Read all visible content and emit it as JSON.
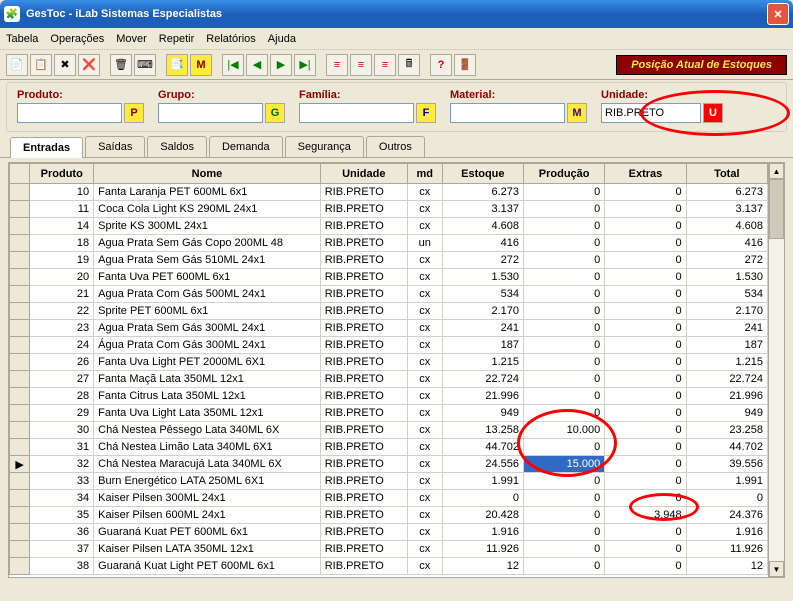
{
  "window": {
    "title": "GesToc - iLab Sistemas Especialistas"
  },
  "menu": [
    "Tabela",
    "Operações",
    "Mover",
    "Repetir",
    "Relatórios",
    "Ajuda"
  ],
  "banner": "Posição Atual de Estoques",
  "filters": {
    "produto": {
      "label": "Produto:",
      "value": "",
      "btn": "P"
    },
    "grupo": {
      "label": "Grupo:",
      "value": "",
      "btn": "G"
    },
    "familia": {
      "label": "Família:",
      "value": "",
      "btn": "F"
    },
    "material": {
      "label": "Material:",
      "value": "",
      "btn": "M"
    },
    "unidade": {
      "label": "Unidade:",
      "value": "RIB.PRETO",
      "btn": "U"
    }
  },
  "tabs": [
    "Entradas",
    "Saídas",
    "Saldos",
    "Demanda",
    "Segurança",
    "Outros"
  ],
  "activeTab": 0,
  "columns": [
    "Produto",
    "Nome",
    "Unidade",
    "md",
    "Estoque",
    "Produção",
    "Extras",
    "Total"
  ],
  "rows": [
    {
      "p": "10",
      "n": "Fanta Laranja PET 600ML 6x1",
      "u": "RIB.PRETO",
      "m": "cx",
      "e": "6.273",
      "pr": "0",
      "x": "0",
      "t": "6.273"
    },
    {
      "p": "11",
      "n": "Coca Cola Light KS 290ML 24x1",
      "u": "RIB.PRETO",
      "m": "cx",
      "e": "3.137",
      "pr": "0",
      "x": "0",
      "t": "3.137"
    },
    {
      "p": "14",
      "n": "Sprite KS 300ML 24x1",
      "u": "RIB.PRETO",
      "m": "cx",
      "e": "4.608",
      "pr": "0",
      "x": "0",
      "t": "4.608"
    },
    {
      "p": "18",
      "n": "Agua Prata Sem Gás Copo 200ML 48",
      "u": "RIB.PRETO",
      "m": "un",
      "e": "416",
      "pr": "0",
      "x": "0",
      "t": "416"
    },
    {
      "p": "19",
      "n": "Agua Prata Sem Gás 510ML 24x1",
      "u": "RIB.PRETO",
      "m": "cx",
      "e": "272",
      "pr": "0",
      "x": "0",
      "t": "272"
    },
    {
      "p": "20",
      "n": "Fanta Uva PET 600ML 6x1",
      "u": "RIB.PRETO",
      "m": "cx",
      "e": "1.530",
      "pr": "0",
      "x": "0",
      "t": "1.530"
    },
    {
      "p": "21",
      "n": "Agua Prata Com Gás 500ML 24x1",
      "u": "RIB.PRETO",
      "m": "cx",
      "e": "534",
      "pr": "0",
      "x": "0",
      "t": "534"
    },
    {
      "p": "22",
      "n": "Sprite PET 600ML 6x1",
      "u": "RIB.PRETO",
      "m": "cx",
      "e": "2.170",
      "pr": "0",
      "x": "0",
      "t": "2.170"
    },
    {
      "p": "23",
      "n": "Agua Prata Sem Gás 300ML 24x1",
      "u": "RIB.PRETO",
      "m": "cx",
      "e": "241",
      "pr": "0",
      "x": "0",
      "t": "241"
    },
    {
      "p": "24",
      "n": "Água Prata Com Gás 300ML 24x1",
      "u": "RIB.PRETO",
      "m": "cx",
      "e": "187",
      "pr": "0",
      "x": "0",
      "t": "187"
    },
    {
      "p": "26",
      "n": "Fanta Uva Light PET 2000ML 6X1",
      "u": "RIB.PRETO",
      "m": "cx",
      "e": "1.215",
      "pr": "0",
      "x": "0",
      "t": "1.215"
    },
    {
      "p": "27",
      "n": "Fanta Maçã Lata 350ML 12x1",
      "u": "RIB.PRETO",
      "m": "cx",
      "e": "22.724",
      "pr": "0",
      "x": "0",
      "t": "22.724"
    },
    {
      "p": "28",
      "n": "Fanta Citrus Lata 350ML 12x1",
      "u": "RIB.PRETO",
      "m": "cx",
      "e": "21.996",
      "pr": "0",
      "x": "0",
      "t": "21.996"
    },
    {
      "p": "29",
      "n": "Fanta Uva Light Lata 350ML 12x1",
      "u": "RIB.PRETO",
      "m": "cx",
      "e": "949",
      "pr": "0",
      "x": "0",
      "t": "949"
    },
    {
      "p": "30",
      "n": "Chá Nestea Pêssego Lata 340ML 6X",
      "u": "RIB.PRETO",
      "m": "cx",
      "e": "13.258",
      "pr": "10.000",
      "x": "0",
      "t": "23.258"
    },
    {
      "p": "31",
      "n": "Chá Nestea Limão Lata 340ML 6X1",
      "u": "RIB.PRETO",
      "m": "cx",
      "e": "44.702",
      "pr": "0",
      "x": "0",
      "t": "44.702"
    },
    {
      "p": "32",
      "n": "Chá Nestea Maracujá Lata 340ML 6X",
      "u": "RIB.PRETO",
      "m": "cx",
      "e": "24.556",
      "pr": "15.000",
      "x": "0",
      "t": "39.556",
      "sel": true,
      "cur": true
    },
    {
      "p": "33",
      "n": "Burn Energético LATA 250ML 6X1",
      "u": "RIB.PRETO",
      "m": "cx",
      "e": "1.991",
      "pr": "0",
      "x": "0",
      "t": "1.991"
    },
    {
      "p": "34",
      "n": "Kaiser Pilsen 300ML 24x1",
      "u": "RIB.PRETO",
      "m": "cx",
      "e": "0",
      "pr": "0",
      "x": "0",
      "t": "0"
    },
    {
      "p": "35",
      "n": "Kaiser Pilsen 600ML 24x1",
      "u": "RIB.PRETO",
      "m": "cx",
      "e": "20.428",
      "pr": "0",
      "x": "3.948",
      "t": "24.376"
    },
    {
      "p": "36",
      "n": "Guaraná Kuat PET 600ML 6x1",
      "u": "RIB.PRETO",
      "m": "cx",
      "e": "1.916",
      "pr": "0",
      "x": "0",
      "t": "1.916"
    },
    {
      "p": "37",
      "n": "Kaiser Pilsen LATA 350ML 12x1",
      "u": "RIB.PRETO",
      "m": "cx",
      "e": "11.926",
      "pr": "0",
      "x": "0",
      "t": "11.926"
    },
    {
      "p": "38",
      "n": "Guaraná Kuat Light PET 600ML 6x1",
      "u": "RIB.PRETO",
      "m": "cx",
      "e": "12",
      "pr": "0",
      "x": "0",
      "t": "12"
    }
  ],
  "toolbar_icons": [
    "📄",
    "📋",
    "✖",
    "❌",
    "🗑",
    "⌨",
    "📑",
    "M",
    "⏮",
    "◀",
    "▶",
    "⏭",
    "≡",
    "≡",
    "≡",
    "🖩",
    "?",
    "🚪"
  ]
}
